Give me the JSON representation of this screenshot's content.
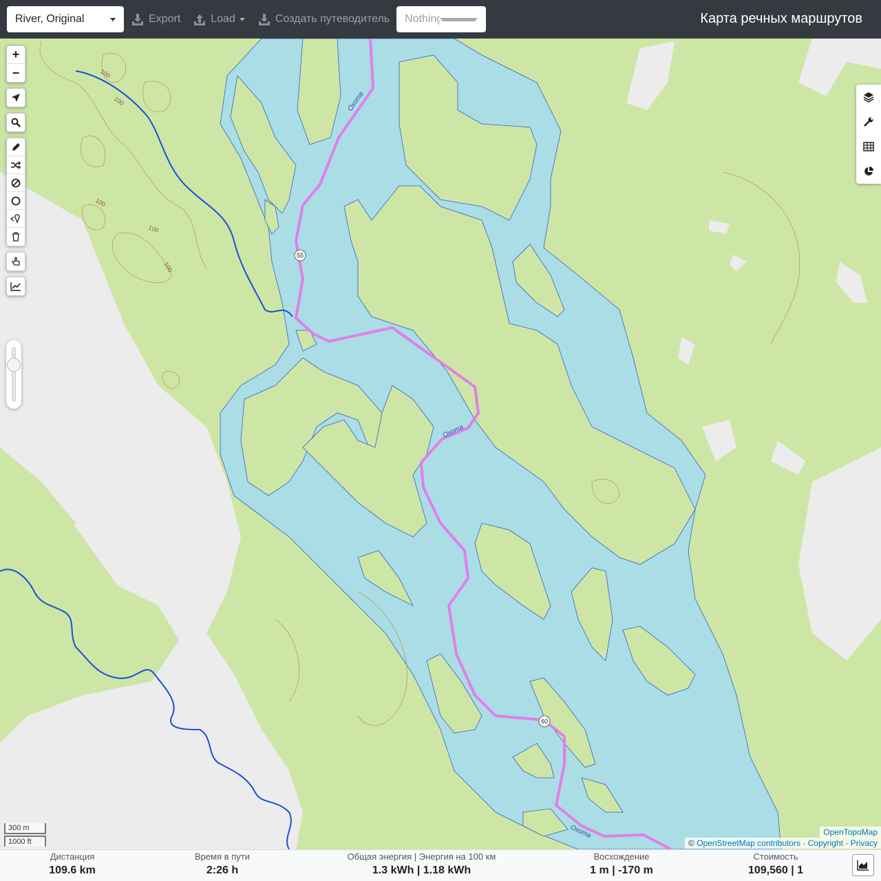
{
  "topbar": {
    "profile": "River, Original",
    "export_label": "Export",
    "load_label": "Load",
    "guide_label": "Создать путеводитель",
    "selection_placeholder": "Nothing selected",
    "title": "Карта речных маршрутов"
  },
  "map": {
    "river_label": "Охота",
    "markers": [
      "55",
      "60"
    ],
    "contour_label": "100",
    "colors": {
      "water": "#aadde6",
      "forest": "#cde6a6",
      "route": "#e080e8",
      "stream": "#1a4fd6"
    }
  },
  "controls": {
    "zoom_in": "+",
    "zoom_out": "−"
  },
  "scale": {
    "metric": "300 m",
    "imperial": "1000 ft"
  },
  "attribution": {
    "tiles": "OpenTopoMap",
    "prefix": "©",
    "osm": "OpenStreetMap contributors",
    "copyright": "Copyright",
    "privacy": "Privacy"
  },
  "stats": {
    "distance_label": "Дистанция",
    "distance_value": "109.6 km",
    "time_label": "Время в пути",
    "time_value": "2:26 h",
    "energy_label": "Общая энергия | Энергия на 100 км",
    "energy_value": "1.3 kWh | 1.18 kWh",
    "ascent_label": "Восхождение",
    "ascent_value": "1 m | -170 m",
    "cost_label": "Стоимость",
    "cost_value": "109,560 | 1"
  }
}
